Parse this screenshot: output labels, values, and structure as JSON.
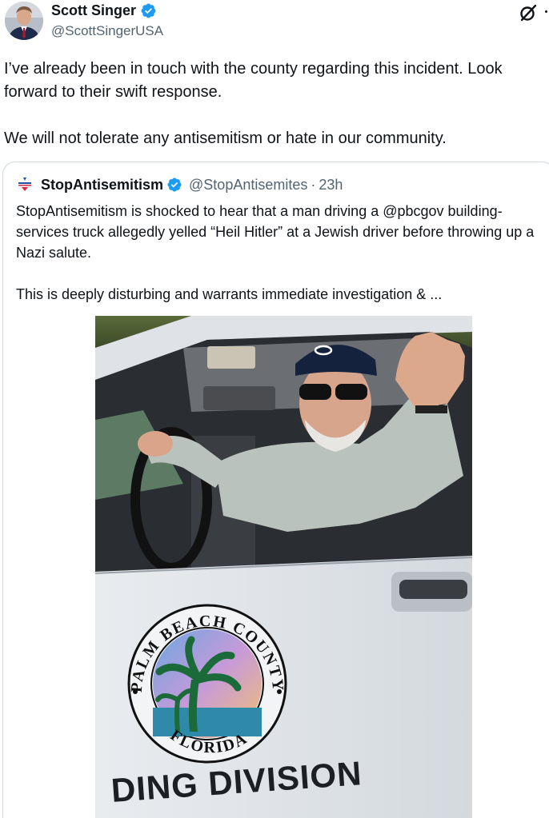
{
  "author": {
    "display_name": "Scott Singer",
    "handle": "@ScottSingerUSA",
    "verified": true,
    "verified_color": "#1d9bf0"
  },
  "tweet": {
    "paragraphs": [
      "I’ve already been in touch with the county regarding this incident. Look forward to their swift response.",
      "We will not tolerate any antisemitism or hate in our community."
    ]
  },
  "header_icons": {
    "grok": "grok-slash-circle-icon",
    "more": "more-options-icon"
  },
  "quoted_tweet": {
    "display_name": "StopAntisemitism",
    "handle": "@StopAntisemites",
    "separator": "·",
    "time": "23h",
    "verified": true,
    "avatar_icon": "stopantisemitism-logo-icon",
    "paragraphs": [
      "StopAntisemitism is shocked to hear that a man driving a @pbcgov building-services truck allegedly  yelled “Heil Hitler” at a Jewish driver before throwing up a Nazi salute.",
      "This is deeply disturbing and warrants immediate investigation & ..."
    ],
    "media": {
      "seal_top_text": "PALM BEACH COUNTY",
      "seal_bottom_text": "FLORIDA",
      "door_text": "DING DIVISION"
    }
  },
  "colors": {
    "text_primary": "#0f1419",
    "text_secondary": "#536471",
    "border": "#cfd9de",
    "verified": "#1d9bf0"
  }
}
